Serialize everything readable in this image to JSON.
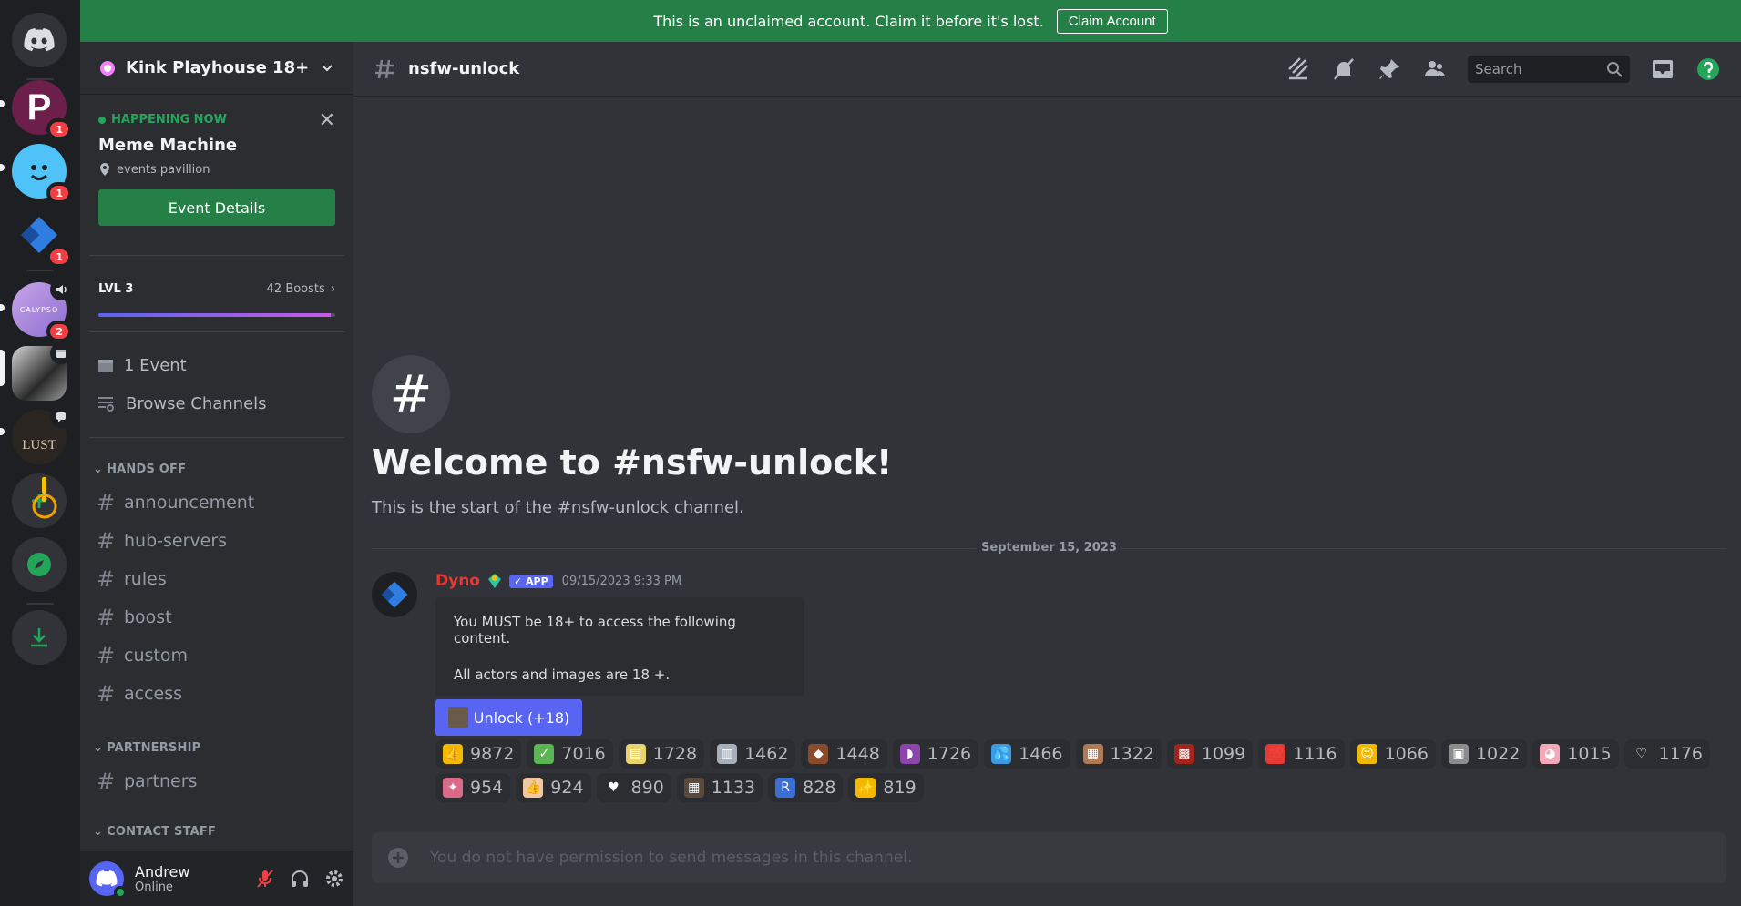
{
  "banner": {
    "text": "This is an unclaimed account. Claim it before it's lost.",
    "button": "Claim Account"
  },
  "servers": [
    {
      "name": "P server",
      "badge": "1"
    },
    {
      "name": "Smiley server",
      "badge": "1"
    },
    {
      "name": "Dyno server",
      "badge": "1"
    },
    {
      "name": "Calypso server",
      "badge": "2",
      "icon_text": "CALYPSO"
    },
    {
      "name": "Black and white server",
      "badge": ""
    },
    {
      "name": "Lust server",
      "badge": "",
      "icon_text": "LUST"
    }
  ],
  "guild": {
    "name": "Kink Playhouse 18+"
  },
  "event": {
    "status": "HAPPENING NOW",
    "title": "Meme Machine",
    "location": "events pavillion",
    "button": "Event Details"
  },
  "boost": {
    "level": "LVL 3",
    "count": "42 Boosts",
    "progress": 0.98
  },
  "nav": {
    "events": "1 Event",
    "browse": "Browse Channels"
  },
  "categories": [
    {
      "name": "HANDS OFF",
      "channels": [
        "announcement",
        "hub-servers",
        "rules",
        "boost",
        "custom",
        "access"
      ]
    },
    {
      "name": "PARTNERSHIP",
      "channels": [
        "partners"
      ]
    },
    {
      "name": "CONTACT STAFF",
      "channels": []
    }
  ],
  "user": {
    "name": "Andrew",
    "status": "Online"
  },
  "channel": {
    "name": "nsfw-unlock",
    "search_placeholder": "Search"
  },
  "welcome": {
    "title": "Welcome to #nsfw-unlock!",
    "subtitle": "This is the start of the #nsfw-unlock channel."
  },
  "date_divider": "September 15, 2023",
  "message": {
    "author": "Dyno",
    "app_tag": "✓ APP",
    "timestamp": "09/15/2023 9:33 PM",
    "embed_lines": [
      "You MUST be 18+ to access the following content.",
      "All actors and images are 18 +."
    ],
    "button": "Unlock (+18)"
  },
  "reactions_row1": [
    {
      "emoji": "👍",
      "count": "9872",
      "color": "#f5b800"
    },
    {
      "emoji": "✓",
      "count": "7016",
      "color": "#5ab552"
    },
    {
      "emoji": "▤",
      "count": "1728",
      "color": "#e9d36a"
    },
    {
      "emoji": "▥",
      "count": "1462",
      "color": "#a7b0ba"
    },
    {
      "emoji": "◆",
      "count": "1448",
      "color": "#8a4b2c"
    },
    {
      "emoji": "◗",
      "count": "1726",
      "color": "#8e44ad"
    },
    {
      "emoji": "💦",
      "count": "1466",
      "color": "#3b9ae1"
    },
    {
      "emoji": "▦",
      "count": "1322",
      "color": "#b07a55"
    },
    {
      "emoji": "▩",
      "count": "1099",
      "color": "#a3231d"
    },
    {
      "emoji": "💯",
      "count": "1116",
      "color": "#e53935"
    },
    {
      "emoji": "☺",
      "count": "1066",
      "color": "#f5b800"
    },
    {
      "emoji": "▣",
      "count": "1022",
      "color": "#8c8c8c"
    },
    {
      "emoji": "◕",
      "count": "1015",
      "color": "#f3a9b8"
    },
    {
      "emoji": "♡",
      "count": "1176",
      "color": "#2b2d31"
    }
  ],
  "reactions_row2": [
    {
      "emoji": "✦",
      "count": "954",
      "color": "#d96b8a"
    },
    {
      "emoji": "👍",
      "count": "924",
      "color": "#f0c7a0"
    },
    {
      "emoji": "♥",
      "count": "890",
      "color": "#2b2d31"
    },
    {
      "emoji": "▦",
      "count": "1133",
      "color": "#5a4a3c"
    },
    {
      "emoji": "R",
      "count": "828",
      "color": "#3b6fd1"
    },
    {
      "emoji": "✨",
      "count": "819",
      "color": "#f5b800"
    }
  ],
  "composer": {
    "placeholder": "You do not have permission to send messages in this channel."
  },
  "colors": {
    "accent": "#5865f2",
    "green": "#248046",
    "online": "#23a55a",
    "badge": "#f23f43"
  }
}
